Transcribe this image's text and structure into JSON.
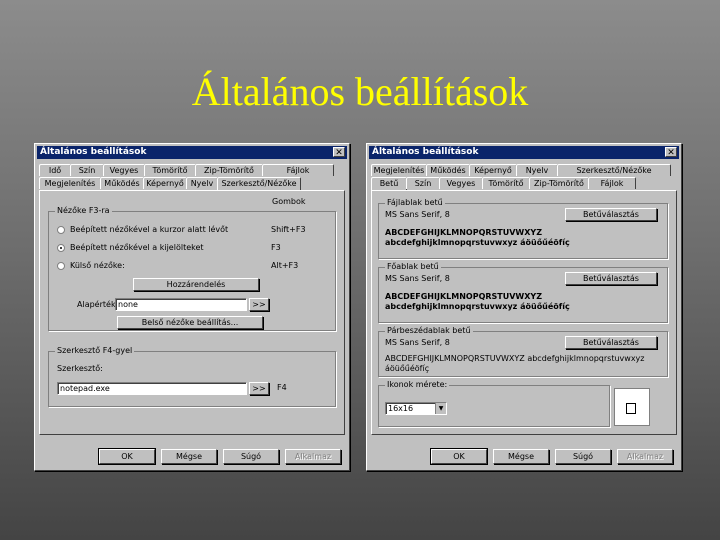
{
  "slide_title": "Általános beállítások",
  "left_dialog": {
    "title": "Általános beállítások",
    "close_glyph": "✕",
    "tabs_row1": [
      "Idő",
      "Szín",
      "Vegyes",
      "Tömörítő",
      "Zip-Tömörítő",
      "Fájlok"
    ],
    "tabs_row2": [
      "Megjelenítés",
      "Működés",
      "Képernyő",
      "Nyelv",
      "Szerkesztő/Nézőke"
    ],
    "active_tab": "Szerkesztő/Nézőke",
    "gombok_label": "Gombok",
    "group_viewer": {
      "legend": "Nézőke F3-ra",
      "options": [
        {
          "label": "Beépített nézőkével a kurzor alatt lévőt",
          "key": "Shift+F3",
          "selected": false
        },
        {
          "label": "Beépített nézőkével a kijelölteket",
          "key": "F3",
          "selected": true
        },
        {
          "label": "Külső nézőke:",
          "key": "Alt+F3",
          "selected": false
        }
      ],
      "assoc_button": "Hozzárendelés",
      "default_label": "Alapérték:",
      "default_value": "none",
      "browse": ">>",
      "inner_button": "Belső nézőke beállítás..."
    },
    "group_editor": {
      "legend": "Szerkesztő F4-gyel",
      "editor_label": "Szerkesztő:",
      "editor_value": "notepad.exe",
      "browse": ">>",
      "key": "F4"
    },
    "buttons": {
      "ok": "OK",
      "cancel": "Mégse",
      "help": "Súgó",
      "apply": "Alkalmaz"
    }
  },
  "right_dialog": {
    "title": "Általános beállítások",
    "close_glyph": "✕",
    "tabs_row1": [
      "Megjelenítés",
      "Működés",
      "Képernyő",
      "Nyelv",
      "Szerkesztő/Nézőke"
    ],
    "tabs_row2": [
      "Betű",
      "Szín",
      "Vegyes",
      "Tömörítő",
      "Zip-Tömörítő",
      "Fájlok"
    ],
    "active_tab": "Betű",
    "font_groups": [
      {
        "legend": "Fájlablak betű",
        "font": "MS Sans Serif, 8",
        "button": "Betűválasztás",
        "sample1": "ABCDEFGHIJKLMNOPQRSTUVWXYZ",
        "sample2": "abcdefghijklmnopqrstuvwxyz áöüőűéöfíç",
        "bold": true
      },
      {
        "legend": "Főablak betű",
        "font": "MS Sans Serif, 8",
        "button": "Betűválasztás",
        "sample1": "ABCDEFGHIJKLMNOPQRSTUVWXYZ",
        "sample2": "abcdefghijklmnopqrstuvwxyz áöüőűéöfíç",
        "bold": true
      },
      {
        "legend": "Párbeszédablak betű",
        "font": "MS Sans Serif, 8",
        "button": "Betűválasztás",
        "sample1": "ABCDEFGHIJKLMNOPQRSTUVWXYZ abcdefghijklmnopqrstuvwxyz",
        "sample2": "áöüőűéöfíç",
        "bold": false
      }
    ],
    "icon_group": {
      "legend": "Ikonok mérete:",
      "value": "16x16",
      "arrow": "▼"
    },
    "buttons": {
      "ok": "OK",
      "cancel": "Mégse",
      "help": "Súgó",
      "apply": "Alkalmaz"
    }
  }
}
